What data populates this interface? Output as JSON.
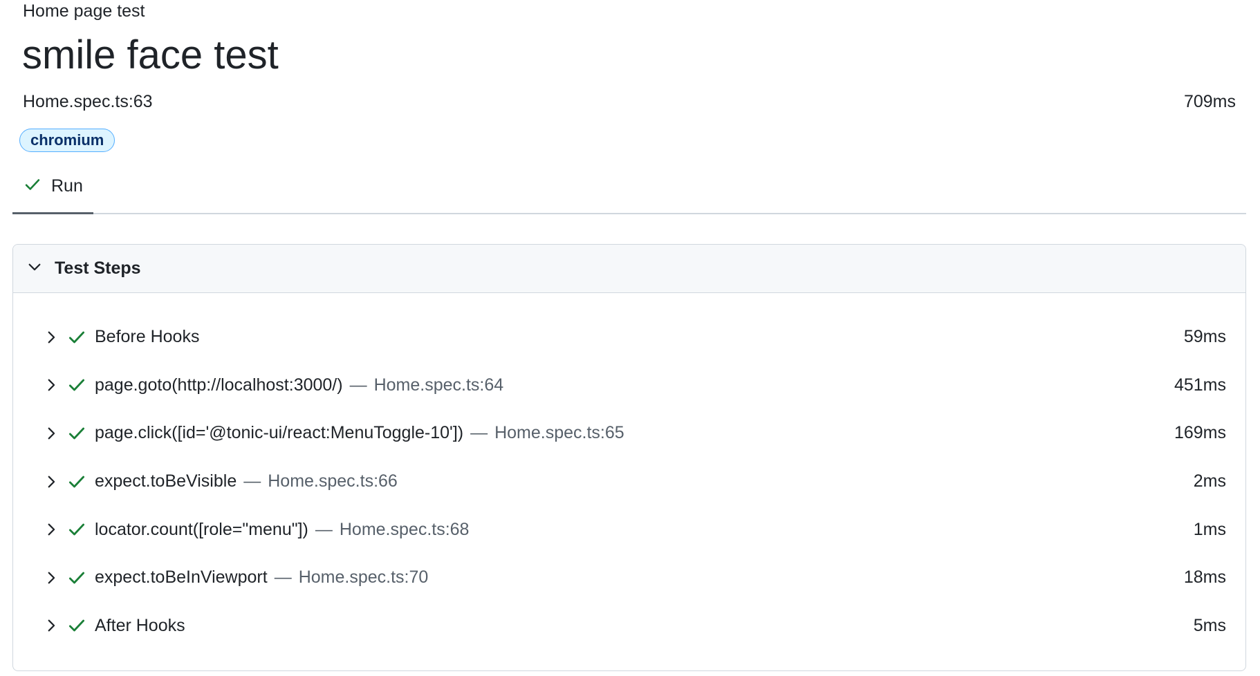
{
  "header": {
    "breadcrumb": "Home page test",
    "title": "smile face test",
    "location": "Home.spec.ts:63",
    "duration": "709ms",
    "project_badge": "chromium"
  },
  "tabs": [
    {
      "label": "Run",
      "status": "passed",
      "icon": "check-icon",
      "selected": true
    }
  ],
  "steps_section": {
    "title": "Test Steps",
    "expanded": true,
    "separator": "—",
    "items": [
      {
        "title": "Before Hooks",
        "location": "",
        "duration": "59ms",
        "status": "passed"
      },
      {
        "title": "page.goto(http://localhost:3000/)",
        "location": "Home.spec.ts:64",
        "duration": "451ms",
        "status": "passed"
      },
      {
        "title": "page.click([id='@tonic-ui/react:MenuToggle-10'])",
        "location": "Home.spec.ts:65",
        "duration": "169ms",
        "status": "passed"
      },
      {
        "title": "expect.toBeVisible",
        "location": "Home.spec.ts:66",
        "duration": "2ms",
        "status": "passed"
      },
      {
        "title": "locator.count([role=\"menu\"])",
        "location": "Home.spec.ts:68",
        "duration": "1ms",
        "status": "passed"
      },
      {
        "title": "expect.toBeInViewport",
        "location": "Home.spec.ts:70",
        "duration": "18ms",
        "status": "passed"
      },
      {
        "title": "After Hooks",
        "location": "",
        "duration": "5ms",
        "status": "passed"
      }
    ]
  },
  "colors": {
    "passed": "#1a7f37",
    "badge_bg": "#ddf4ff",
    "badge_text": "#0a3069",
    "muted_text": "#57606a"
  }
}
